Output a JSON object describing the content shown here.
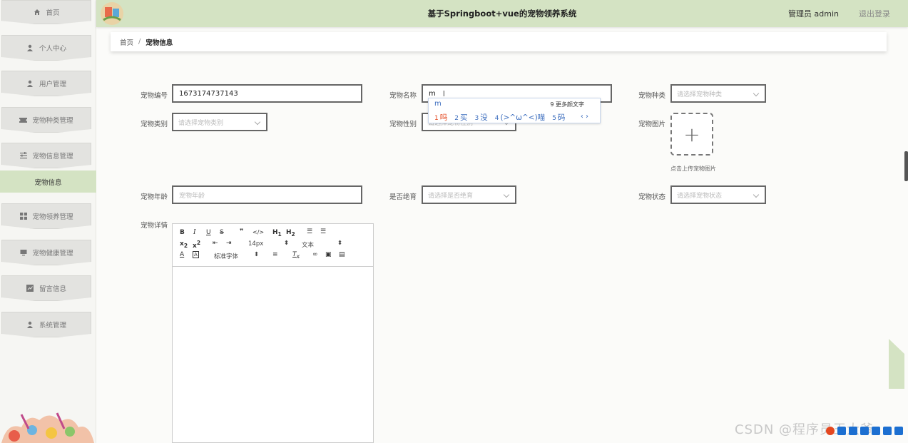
{
  "header": {
    "title": "基于Springboot+vue的宠物领养系统",
    "admin_text": "管理员 admin",
    "logout_label": "退出登录"
  },
  "sidebar": {
    "items": [
      {
        "label": "首页",
        "icon": "home-icon"
      },
      {
        "label": "个人中心",
        "icon": "user-icon"
      },
      {
        "label": "用户管理",
        "icon": "user-icon"
      },
      {
        "label": "宠物种类管理",
        "icon": "ticket-icon"
      },
      {
        "label": "宠物信息管理",
        "icon": "sliders-icon"
      },
      {
        "label": "宠物领养管理",
        "icon": "grid-icon"
      },
      {
        "label": "宠物健康管理",
        "icon": "monitor-icon"
      },
      {
        "label": "留言信息",
        "icon": "chart-icon"
      },
      {
        "label": "系统管理",
        "icon": "user-icon"
      }
    ],
    "active_sub": "宠物信息"
  },
  "breadcrumb": {
    "home": "首页",
    "sep": "/",
    "current": "宠物信息"
  },
  "form": {
    "pet_no": {
      "label": "宠物编号",
      "value": "1673174737143"
    },
    "pet_name": {
      "label": "宠物名称",
      "value": "m"
    },
    "pet_kind": {
      "label": "宠物种类",
      "placeholder": "请选择宠物种类"
    },
    "pet_type": {
      "label": "宠物类别",
      "placeholder": "请选择宠物类别"
    },
    "pet_gender": {
      "label": "宠物性别",
      "placeholder": "请选择宠物性别"
    },
    "pet_image": {
      "label": "宠物图片",
      "hint": "点击上传宠物图片"
    },
    "pet_age": {
      "label": "宠物年龄",
      "placeholder": "宠物年龄"
    },
    "neutered": {
      "label": "是否绝育",
      "placeholder": "请选择是否绝育"
    },
    "pet_status": {
      "label": "宠物状态",
      "placeholder": "请选择宠物状态"
    },
    "pet_detail": {
      "label": "宠物详情"
    }
  },
  "editor": {
    "font_size": "14px",
    "text_style": "文本",
    "font_family": "标准字体"
  },
  "ime": {
    "composition": "m",
    "more_label": "9 更多颜文字",
    "candidates": [
      {
        "n": "1",
        "text": "吗"
      },
      {
        "n": "2",
        "text": "买"
      },
      {
        "n": "3",
        "text": "没"
      },
      {
        "n": "4",
        "text": "(>^ω^<)喵"
      },
      {
        "n": "5",
        "text": "码"
      }
    ],
    "nav": "‹ ›"
  },
  "watermark": "CSDN @程序员王大爷",
  "colors": {
    "accent": "#d4e3c3",
    "ime_blue": "#3e6fbf",
    "ime_red": "#e4471f"
  }
}
